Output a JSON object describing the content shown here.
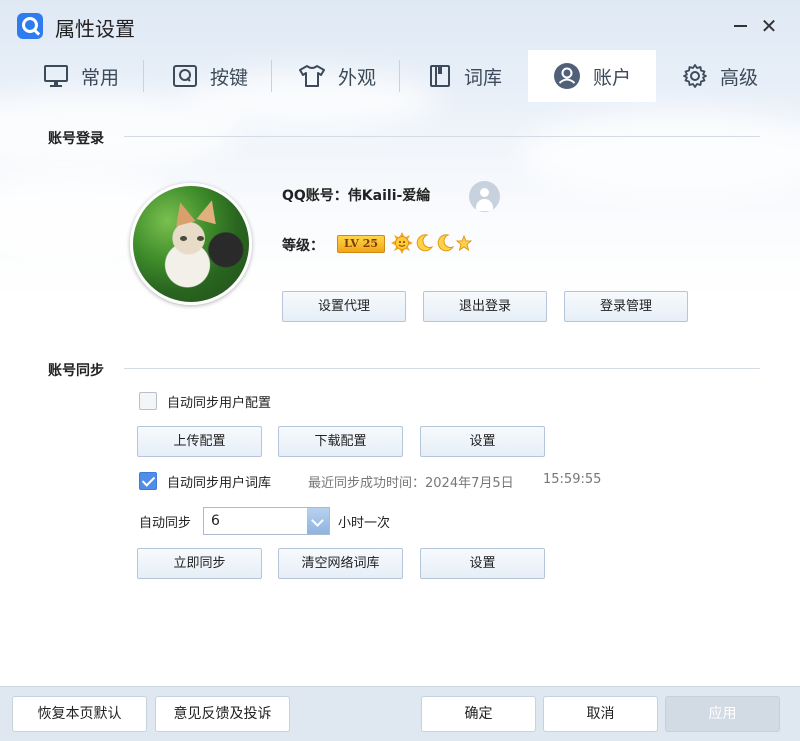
{
  "window": {
    "title": "属性设置"
  },
  "tabs": [
    {
      "label": "常用",
      "icon": "monitor-icon"
    },
    {
      "label": "按键",
      "icon": "key-q-icon"
    },
    {
      "label": "外观",
      "icon": "shirt-icon"
    },
    {
      "label": "词库",
      "icon": "book-icon"
    },
    {
      "label": "账户",
      "icon": "user-circle-icon",
      "active": true
    },
    {
      "label": "高级",
      "icon": "gear-icon"
    }
  ],
  "login": {
    "section_title": "账号登录",
    "account_text": "QQ账号：伟Kaili-爱綸",
    "level_label": "等级：",
    "level_badge": "LV 25",
    "buttons": {
      "proxy": "设置代理",
      "logout": "退出登录",
      "manage": "登录管理"
    }
  },
  "sync": {
    "section_title": "账号同步",
    "auto_sync_config_label": "自动同步用户配置",
    "auto_sync_config_checked": false,
    "config_buttons": {
      "upload": "上传配置",
      "download": "下载配置",
      "settings": "设置"
    },
    "auto_sync_dict_label": "自动同步用户词库",
    "auto_sync_dict_checked": true,
    "last_sync_text": "最近同步成功时间：2024年7月5日",
    "last_sync_time": "15:59:55",
    "interval_label": "自动同步",
    "interval_value": "6",
    "interval_suffix": "小时一次",
    "dict_buttons": {
      "sync_now": "立即同步",
      "clear": "清空网络词库",
      "settings": "设置"
    }
  },
  "footer": {
    "restore": "恢复本页默认",
    "feedback": "意见反馈及投诉",
    "ok": "确定",
    "cancel": "取消",
    "apply": "应用"
  },
  "colors": {
    "accent": "#2f7cf0",
    "checkbox_checked": "#4e8ee9",
    "level_badge": "#f2a516"
  }
}
